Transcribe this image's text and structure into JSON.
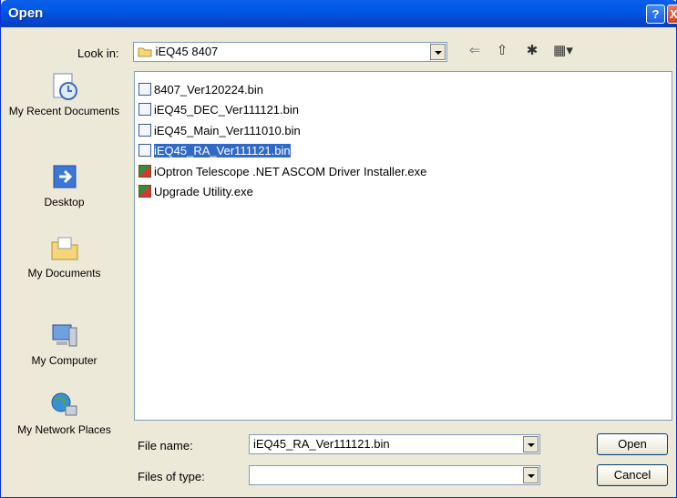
{
  "window": {
    "title": "Open",
    "help_glyph": "?",
    "close_glyph": "X"
  },
  "lookin": {
    "label": "Look in:",
    "value": "iEQ45 8407"
  },
  "toolbar": {
    "back_glyph": "⇐",
    "up_glyph": "⇧",
    "newfolder_glyph": "✱",
    "views_glyph": "▦▾"
  },
  "places": [
    {
      "label": "My Recent Documents",
      "icon": "recent-documents-icon"
    },
    {
      "label": "Desktop",
      "icon": "desktop-icon"
    },
    {
      "label": "My Documents",
      "icon": "my-documents-icon"
    },
    {
      "label": "My Computer",
      "icon": "my-computer-icon"
    },
    {
      "label": "My Network Places",
      "icon": "network-places-icon"
    }
  ],
  "files": [
    {
      "name": "8407_Ver120224.bin",
      "type": "bin",
      "selected": false
    },
    {
      "name": "iEQ45_DEC_Ver111121.bin",
      "type": "bin",
      "selected": false
    },
    {
      "name": "iEQ45_Main_Ver111010.bin",
      "type": "bin",
      "selected": false
    },
    {
      "name": "iEQ45_RA_Ver111121.bin",
      "type": "bin",
      "selected": true
    },
    {
      "name": "iOptron Telescope .NET ASCOM Driver Installer.exe",
      "type": "exe",
      "selected": false
    },
    {
      "name": "Upgrade Utility.exe",
      "type": "exe",
      "selected": false
    }
  ],
  "filename": {
    "label": "File name:",
    "value": "iEQ45_RA_Ver111121.bin"
  },
  "filetype": {
    "label": "Files of type:",
    "value": ""
  },
  "buttons": {
    "open": "Open",
    "cancel": "Cancel"
  },
  "colors": {
    "titlebar": "#0058e6",
    "selection": "#316ac5",
    "face": "#ece9d8"
  }
}
